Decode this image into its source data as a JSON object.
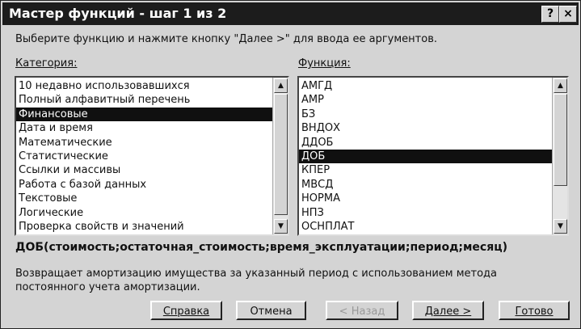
{
  "window": {
    "title": "Мастер функций - шаг 1 из 2",
    "help_label": "?",
    "close_label": "×"
  },
  "instruction": "Выберите функцию и нажмите кнопку \"Далее >\" для ввода ее аргументов.",
  "category": {
    "label": "Категория:",
    "items": [
      "10 недавно использовавшихся",
      "Полный алфавитный перечень",
      "Финансовые",
      "Дата и время",
      "Математические",
      "Статистические",
      "Ссылки и массивы",
      "Работа с базой данных",
      "Текстовые",
      "Логические",
      "Проверка свойств и значений"
    ],
    "selected": "Финансовые"
  },
  "function": {
    "label": "Функция:",
    "items": [
      "АМГД",
      "АМР",
      "БЗ",
      "ВНДОХ",
      "ДДОБ",
      "ДОБ",
      "КПЕР",
      "МВСД",
      "НОРМА",
      "НПЗ",
      "ОСНПЛАТ"
    ],
    "selected": "ДОБ"
  },
  "signature": "ДОБ(стоимость;остаточная_стоимость;время_эксплуатации;период;месяц)",
  "description": "Возвращает амортизацию имущества за указанный период с использованием метода постоянного учета амортизации.",
  "buttons": {
    "help": "Справка",
    "cancel": "Отмена",
    "back": "< Назад",
    "next": "Далее >",
    "finish": "Готово"
  },
  "scroll": {
    "up_icon": "▲",
    "down_icon": "▼"
  }
}
